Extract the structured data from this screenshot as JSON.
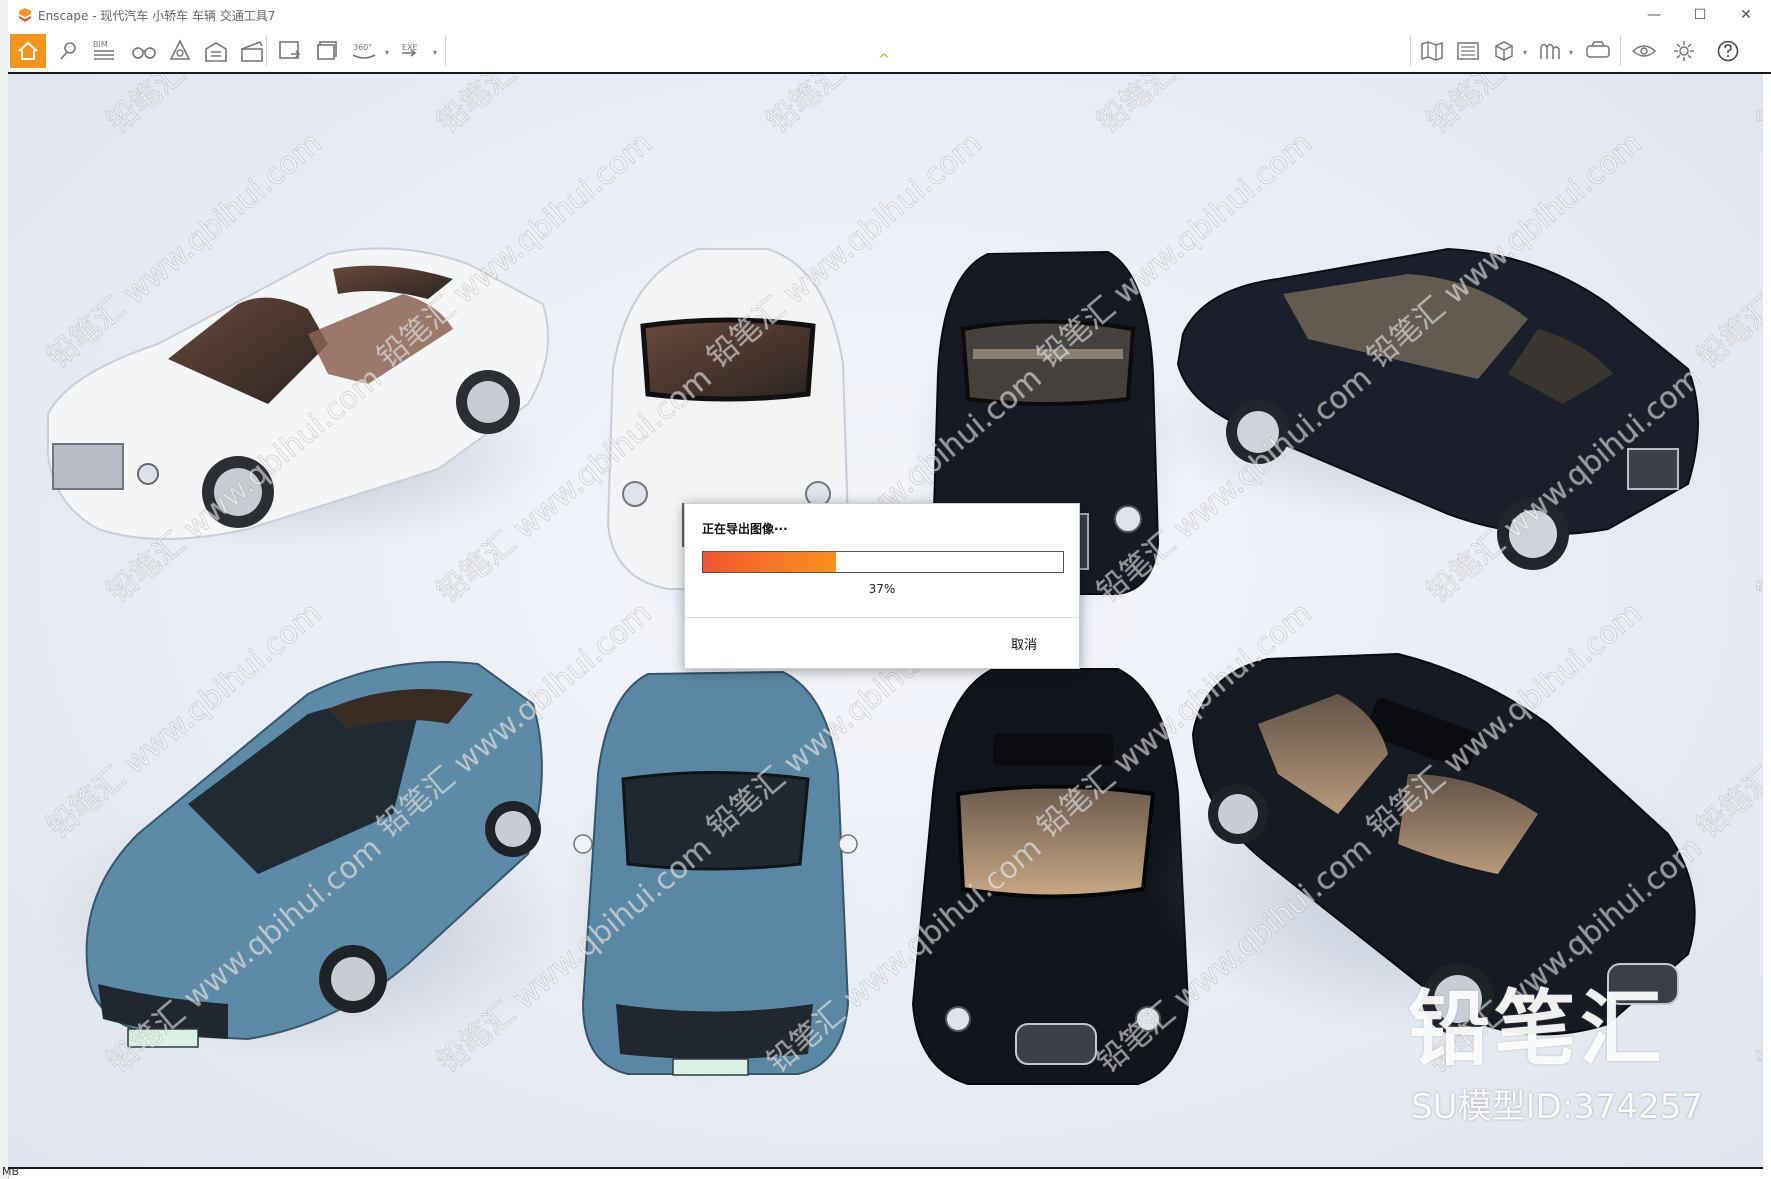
{
  "window": {
    "title": "Enscape - 现代汽车 小轿车 车辆 交通工具7",
    "minimize_label": "—",
    "maximize_label": "☐",
    "close_label": "✕"
  },
  "host_status": "MB",
  "toolbar": {
    "items_left": [
      {
        "name": "home",
        "icon": "home-icon"
      },
      {
        "name": "views",
        "icon": "map-pin-icon"
      },
      {
        "name": "bim",
        "icon": "bim-icon",
        "label": "BIM"
      },
      {
        "name": "binoculars",
        "icon": "binoculars-icon"
      },
      {
        "name": "assets",
        "icon": "asset-library-icon"
      },
      {
        "name": "materials",
        "icon": "building-icon"
      },
      {
        "name": "video",
        "icon": "clapper-icon"
      },
      {
        "name": "screenshot",
        "icon": "screenshot-icon"
      },
      {
        "name": "batch",
        "icon": "batch-render-icon"
      },
      {
        "name": "panorama",
        "icon": "panorama-icon",
        "label": "360°"
      },
      {
        "name": "export",
        "icon": "export-exe-icon",
        "label": "EXE"
      }
    ],
    "items_right": [
      {
        "name": "map",
        "icon": "map-icon"
      },
      {
        "name": "site",
        "icon": "site-context-icon"
      },
      {
        "name": "cube",
        "icon": "cube-icon"
      },
      {
        "name": "collab",
        "icon": "collaboration-icon"
      },
      {
        "name": "vr",
        "icon": "vr-headset-icon"
      },
      {
        "name": "visual",
        "icon": "eye-icon"
      },
      {
        "name": "settings",
        "icon": "gear-icon"
      },
      {
        "name": "help",
        "icon": "help-icon"
      }
    ],
    "collapse_label": "^",
    "accent": "#f7941d"
  },
  "dialog": {
    "title": "正在导出图像···",
    "progress_percent": 37,
    "progress_text": "37%",
    "cancel_label": "取消"
  },
  "overlay": {
    "brand": "铅笔汇",
    "model_id": "SU模型ID:374257",
    "watermark_text": "铅笔汇 www.qbihui.com"
  },
  "scene": {
    "cars": [
      {
        "name": "white-coupe",
        "color": "#f4f5f7"
      },
      {
        "name": "white-coupe-front",
        "color": "#f2f3f5"
      },
      {
        "name": "black-sedan-front",
        "color": "#151a25"
      },
      {
        "name": "black-limousine",
        "color": "#1a1f2b"
      },
      {
        "name": "blue-muscle-car",
        "color": "#5d8aa6"
      },
      {
        "name": "blue-muscle-car-front",
        "color": "#5a87a3"
      },
      {
        "name": "black-jaguar-front",
        "color": "#12151c"
      },
      {
        "name": "black-jaguar",
        "color": "#161a22"
      }
    ]
  }
}
